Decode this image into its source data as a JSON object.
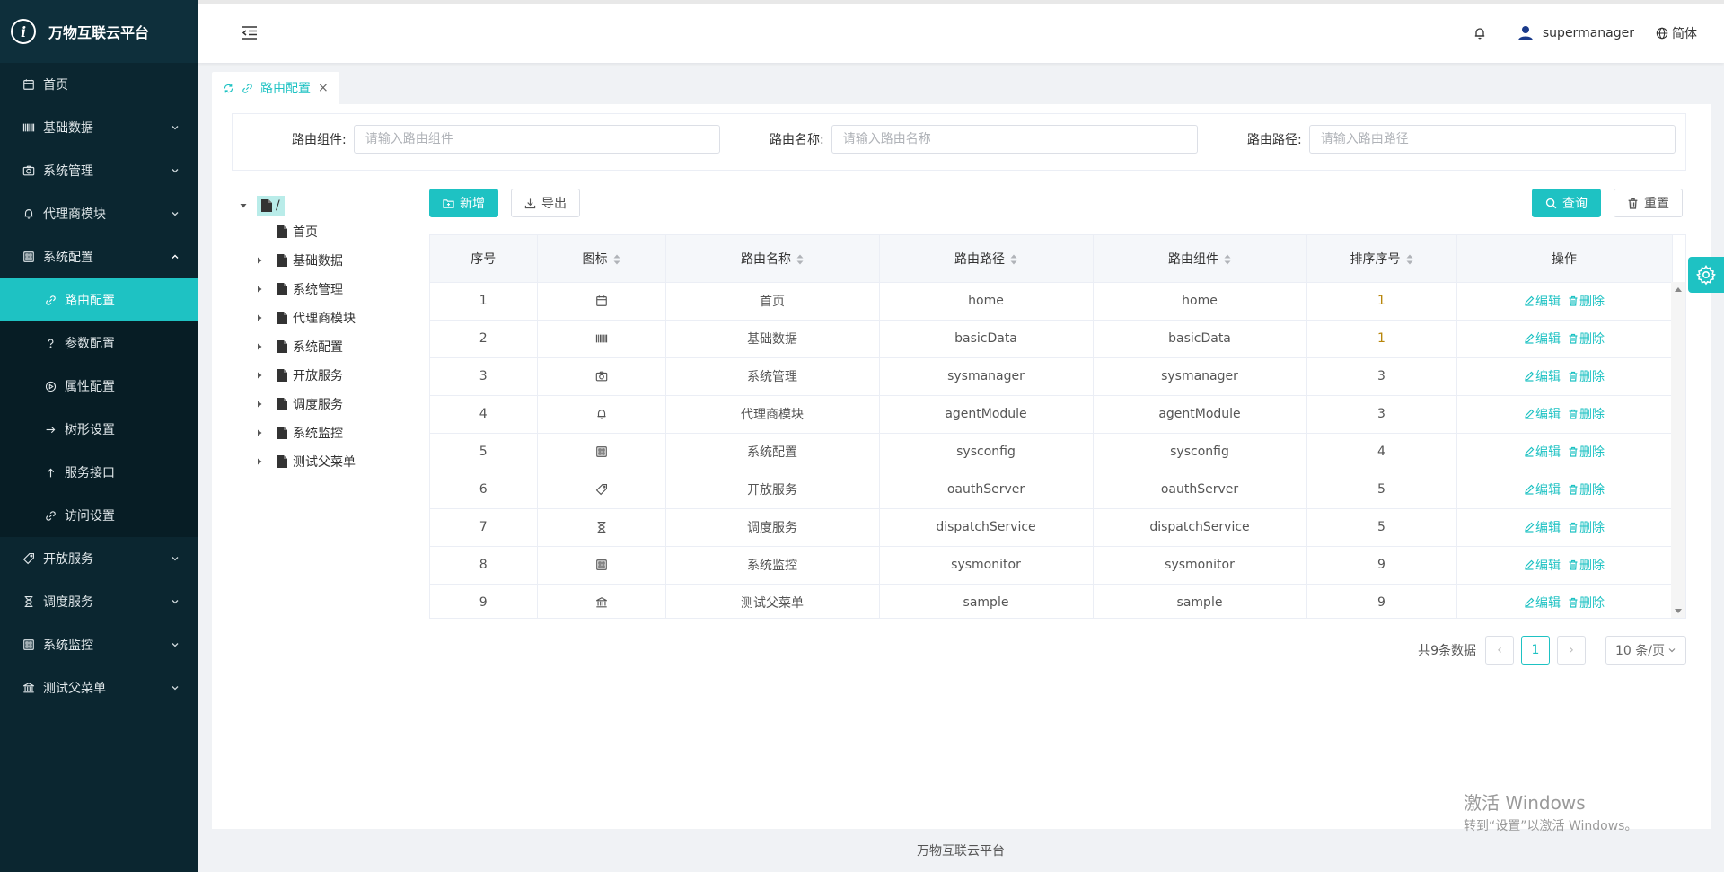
{
  "app": {
    "title": "万物互联云平台"
  },
  "sidebar": {
    "menu": [
      {
        "label": "首页",
        "icon": "calendar-icon"
      },
      {
        "label": "基础数据",
        "icon": "barcode-icon"
      },
      {
        "label": "系统管理",
        "icon": "camera-icon"
      },
      {
        "label": "代理商模块",
        "icon": "bell-icon"
      },
      {
        "label": "系统配置",
        "icon": "grid-icon"
      }
    ],
    "submenu": [
      {
        "label": "路由配置",
        "icon": "link-icon"
      },
      {
        "label": "参数配置",
        "icon": "question-icon"
      },
      {
        "label": "属性配置",
        "icon": "play-circle-icon"
      },
      {
        "label": "树形设置",
        "icon": "arrow-right-icon"
      },
      {
        "label": "服务接口",
        "icon": "arrow-up-icon"
      },
      {
        "label": "访问设置",
        "icon": "link-icon"
      }
    ],
    "menu_after": [
      {
        "label": "开放服务",
        "icon": "tag-icon"
      },
      {
        "label": "调度服务",
        "icon": "hourglass-icon"
      },
      {
        "label": "系统监控",
        "icon": "grid-icon"
      },
      {
        "label": "测试父菜单",
        "icon": "bank-icon"
      }
    ]
  },
  "header": {
    "username": "supermanager",
    "language": "简体"
  },
  "tabs": [
    {
      "label": "路由配置"
    }
  ],
  "search": {
    "component_label": "路由组件:",
    "component_placeholder": "请输入路由组件",
    "name_label": "路由名称:",
    "name_placeholder": "请输入路由名称",
    "path_label": "路由路径:",
    "path_placeholder": "请输入路由路径"
  },
  "tree": {
    "root": "/",
    "nodes": [
      "首页",
      "基础数据",
      "系统管理",
      "代理商模块",
      "系统配置",
      "开放服务",
      "调度服务",
      "系统监控",
      "测试父菜单"
    ]
  },
  "toolbar": {
    "add": "新增",
    "export": "导出",
    "query": "查询",
    "reset": "重置"
  },
  "table": {
    "headers": [
      "序号",
      "图标",
      "路由名称",
      "路由路径",
      "路由组件",
      "排序序号",
      "操作"
    ],
    "rows": [
      {
        "idx": "1",
        "icon": "calendar-icon",
        "name": "首页",
        "path": "home",
        "component": "home",
        "sort": "1"
      },
      {
        "idx": "2",
        "icon": "barcode-icon",
        "name": "基础数据",
        "path": "basicData",
        "component": "basicData",
        "sort": "1"
      },
      {
        "idx": "3",
        "icon": "camera-icon",
        "name": "系统管理",
        "path": "sysmanager",
        "component": "sysmanager",
        "sort": "3"
      },
      {
        "idx": "4",
        "icon": "bell-icon",
        "name": "代理商模块",
        "path": "agentModule",
        "component": "agentModule",
        "sort": "3"
      },
      {
        "idx": "5",
        "icon": "grid-icon",
        "name": "系统配置",
        "path": "sysconfig",
        "component": "sysconfig",
        "sort": "4"
      },
      {
        "idx": "6",
        "icon": "tag-icon",
        "name": "开放服务",
        "path": "oauthServer",
        "component": "oauthServer",
        "sort": "5"
      },
      {
        "idx": "7",
        "icon": "hourglass-icon",
        "name": "调度服务",
        "path": "dispatchService",
        "component": "dispatchService",
        "sort": "5"
      },
      {
        "idx": "8",
        "icon": "grid-icon",
        "name": "系统监控",
        "path": "sysmonitor",
        "component": "sysmonitor",
        "sort": "9"
      },
      {
        "idx": "9",
        "icon": "bank-icon",
        "name": "测试父菜单",
        "path": "sample",
        "component": "sample",
        "sort": "9"
      }
    ],
    "edit_label": "编辑",
    "delete_label": "删除"
  },
  "pagination": {
    "total": "共9条数据",
    "current": "1",
    "page_size": "10 条/页"
  },
  "watermark": {
    "line1": "激活 Windows",
    "line2": "转到“设置”以激活 Windows。"
  },
  "footer": {
    "text": "万物互联云平台"
  },
  "colors": {
    "accent": "#1ec2c3",
    "sidebar_bg": "#0b2630",
    "submenu_bg": "#071d25"
  }
}
